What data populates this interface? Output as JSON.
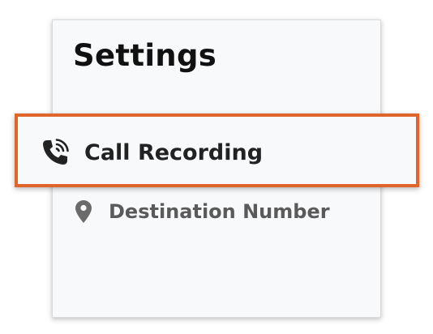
{
  "settings": {
    "title": "Settings",
    "items": [
      {
        "label": "Call Recording",
        "icon": "phone-recording-icon",
        "highlighted": true
      },
      {
        "label": "Destination Number",
        "icon": "map-pin-icon",
        "highlighted": false
      }
    ]
  },
  "colors": {
    "highlight_border": "#e0652a",
    "panel_background": "#f8f9fa",
    "title_text": "#111111",
    "primary_text": "#222222",
    "secondary_text": "#5a5a5a"
  }
}
